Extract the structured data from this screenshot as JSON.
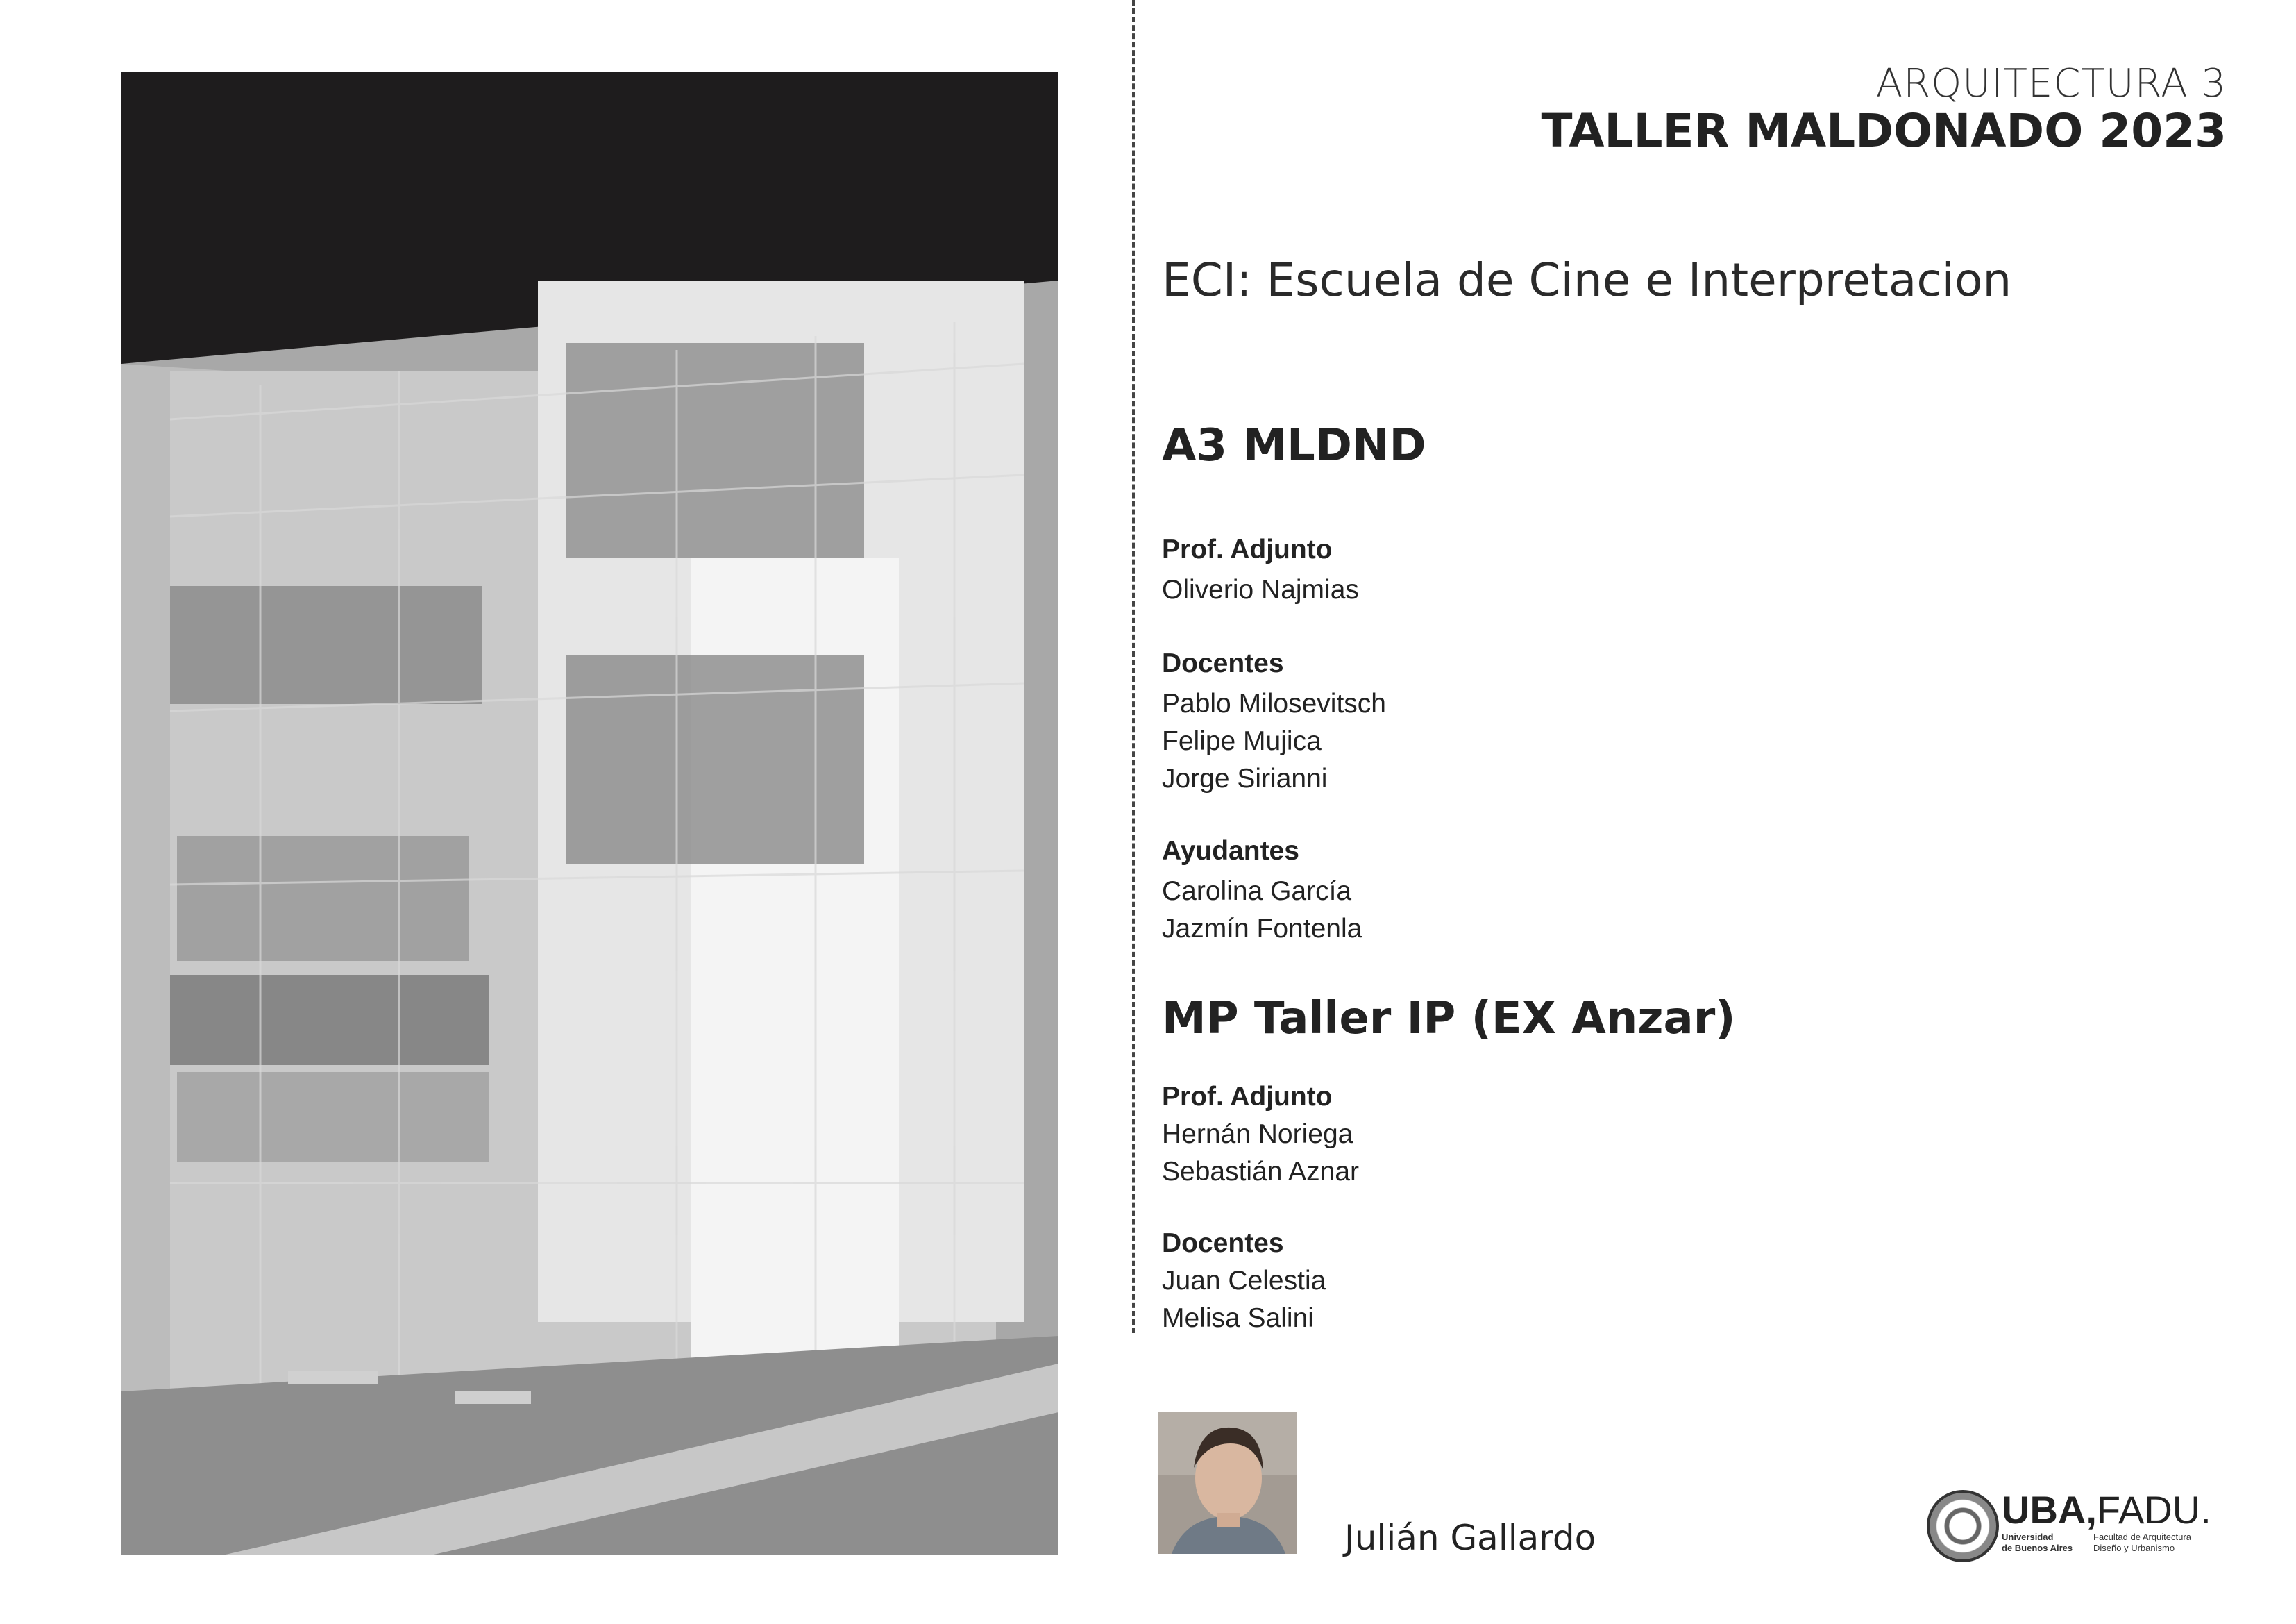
{
  "header": {
    "course": "ARQUITECTURA 3",
    "workshop": "TALLER MALDONADO 2023"
  },
  "project_title": "ECI: Escuela de Cine e Interpretacion",
  "section_a3": {
    "title": "A3 MLDND",
    "prof_role": "Prof. Adjunto",
    "prof_names": [
      "Oliverio Najmias"
    ],
    "docentes_role": "Docentes",
    "docentes_names": [
      "Pablo Milosevitsch",
      "Felipe Mujica",
      "Jorge Sirianni"
    ],
    "ayudantes_role": "Ayudantes",
    "ayudantes_names": [
      "Carolina García",
      "Jazmín Fontenla"
    ]
  },
  "section_mp": {
    "title": "MP Taller IP (EX Anzar)",
    "prof_role": "Prof. Adjunto",
    "prof_names": [
      "Hernán Noriega",
      "Sebastián Aznar"
    ],
    "docentes_role": "Docentes",
    "docentes_names": [
      "Juan Celestia",
      "Melisa Salini"
    ]
  },
  "student_name": "Julián Gallardo",
  "logo": {
    "uba": "UBA,",
    "fadu": "FADU.",
    "univ_line1": "Universidad",
    "univ_line2": "de Buenos Aires",
    "fac_line1": "Facultad de Arquitectura",
    "fac_line2": "Diseño y Urbanismo"
  }
}
